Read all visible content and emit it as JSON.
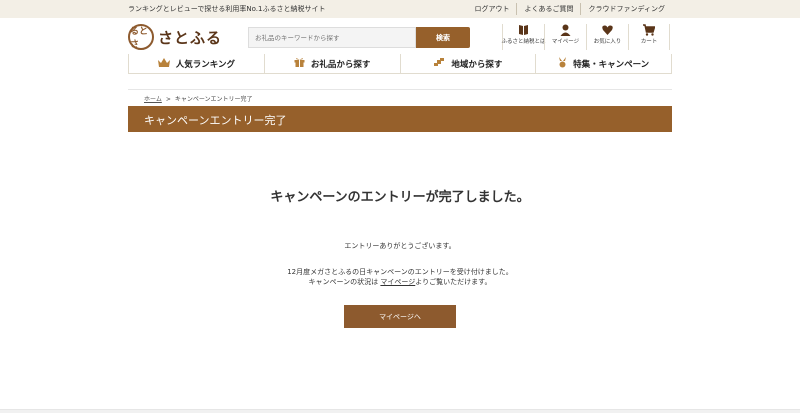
{
  "topbar": {
    "tagline": "ランキングとレビューで探せる利用率No.1ふるさと納税サイト",
    "links": [
      "ログアウト",
      "よくあるご質問",
      "クラウドファンディング"
    ]
  },
  "header": {
    "logo_mark": "るとさ",
    "logo_text": "さとふる",
    "search_placeholder": "お礼品のキーワードから探す",
    "search_button": "検索"
  },
  "icon_nav": [
    {
      "label": "ふるさと納税とは",
      "icon": "book-icon"
    },
    {
      "label": "マイページ",
      "icon": "user-icon"
    },
    {
      "label": "お気に入り",
      "icon": "heart-icon"
    },
    {
      "label": "カート",
      "icon": "cart-icon"
    }
  ],
  "global_nav": [
    {
      "label": "人気ランキング",
      "icon": "crown-icon"
    },
    {
      "label": "お礼品から探す",
      "icon": "gift-icon"
    },
    {
      "label": "地域から探す",
      "icon": "map-icon"
    },
    {
      "label": "特集・キャンペーン",
      "icon": "medal-icon"
    }
  ],
  "breadcrumb": {
    "home": "ホーム",
    "separator": ">",
    "current": "キャンペーンエントリー完了"
  },
  "page_title": "キャンペーンエントリー完了",
  "content": {
    "heading": "キャンペーンのエントリーが完了しました。",
    "thanks": "エントリーありがとうございます。",
    "line1": "12月度メガさとふるの日キャンペーンのエントリーを受け付けました。",
    "line2_prefix": "キャンペーンの状況は ",
    "line2_link": "マイページ",
    "line2_suffix": "よりご覧いただけます。",
    "button": "マイページへ"
  },
  "colors": {
    "brand": "#96602b",
    "topbar_bg": "#f3efe6"
  }
}
